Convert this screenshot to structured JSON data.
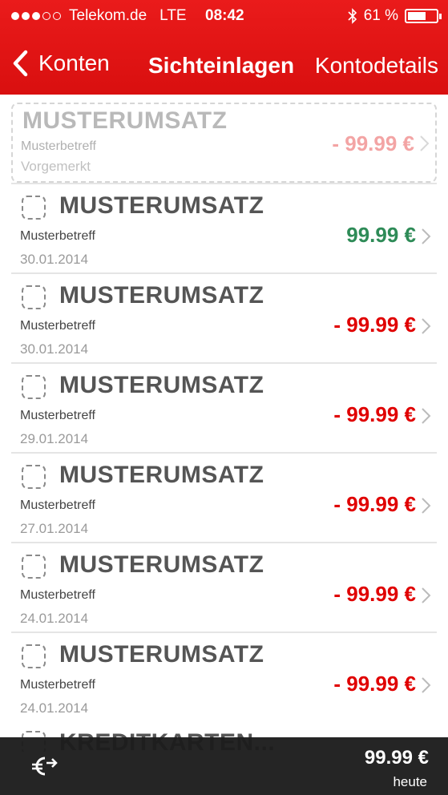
{
  "status_bar": {
    "carrier": "Telekom.de",
    "network": "LTE",
    "time": "08:42",
    "battery": "61 %",
    "battery_level": 0.61
  },
  "nav": {
    "back_label": "Konten",
    "title": "Sichteinlagen",
    "right_label": "Kontodetails"
  },
  "transactions": [
    {
      "title": "MUSTERUMSATZ",
      "subtitle": "Musterbetreff",
      "date": "Vorgemerkt",
      "amount": "- 99.99 €",
      "pending": true
    },
    {
      "title": "MUSTERUMSATZ",
      "subtitle": "Musterbetreff",
      "date": "30.01.2014",
      "amount": "99.99 €",
      "positive": true
    },
    {
      "title": "MUSTERUMSATZ",
      "subtitle": "Musterbetreff",
      "date": "30.01.2014",
      "amount": "- 99.99 €"
    },
    {
      "title": "MUSTERUMSATZ",
      "subtitle": "Musterbetreff",
      "date": "29.01.2014",
      "amount": "- 99.99 €"
    },
    {
      "title": "MUSTERUMSATZ",
      "subtitle": "Musterbetreff",
      "date": "27.01.2014",
      "amount": "- 99.99 €"
    },
    {
      "title": "MUSTERUMSATZ",
      "subtitle": "Musterbetreff",
      "date": "24.01.2014",
      "amount": "- 99.99 €"
    },
    {
      "title": "MUSTERUMSATZ",
      "subtitle": "Musterbetreff",
      "date": "24.01.2014",
      "amount": "- 99.99 €"
    }
  ],
  "peek_row": {
    "title": "KREDITKARTEN..."
  },
  "bottom_bar": {
    "icon": "euro-transfer-icon",
    "total": "99.99 €",
    "total_label": "heute"
  },
  "colors": {
    "header": "#e31414",
    "negative": "#e00000",
    "positive": "#2e8b57",
    "bottom_bar": "#1c1c1c"
  }
}
